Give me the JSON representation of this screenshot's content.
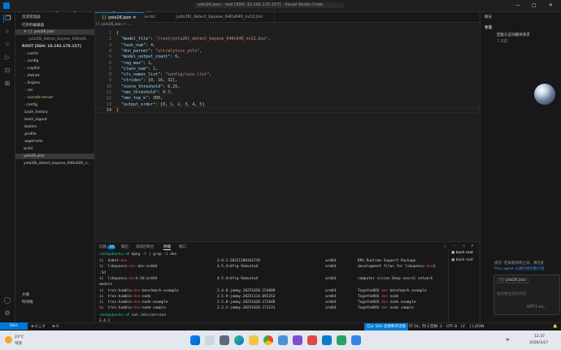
{
  "titlebar": {
    "menu": [
      "文件(F)",
      "编辑(E)",
      "选择(S)",
      "查看(V)",
      "转到(G)",
      "运行(R)",
      "终端(T)",
      "帮助(H)"
    ],
    "title": "yolo26.json - root [SSH: 10.192.170.157] - Visual Studio Code"
  },
  "sidebar": {
    "header": "资源管理器",
    "open_editors": "打开的编辑器",
    "open_files": [
      "yolo26.json",
      "yolo26l_detect_bayese_640x64..."
    ],
    "root": "ROOT [SSH: 10.192.170.157]",
    "items": [
      ".cache",
      ".config",
      ".copilot",
      ".dotnet",
      ".lingma",
      ".ros",
      ".vscode-server",
      "config",
      ".bash_history",
      ".bash_logout",
      ".bashrc",
      ".profile",
      ".wget-hsts",
      "w.list",
      "yolo26.json",
      "yolo26l_detect_bayese_640x640_n..."
    ],
    "outline": "大纲",
    "timeline": "时间线"
  },
  "tabs": [
    "yolo26.json",
    "w.list",
    "yolo26l_detect_bayese_640x640_nv12.bin"
  ],
  "breadcrumb": "{} yolo26.json > ...",
  "editor": {
    "lines": [
      [
        [
          "p",
          "{"
        ]
      ],
      [
        [
          "k",
          "\"model_file\""
        ],
        [
          "p",
          ": "
        ],
        [
          "s",
          "\"/root/yolo26l_detect_bayese_640x640_nv12.bin\""
        ],
        [
          "p",
          ","
        ]
      ],
      [
        [
          "k",
          "\"task_num\""
        ],
        [
          "p",
          ": "
        ],
        [
          "n",
          "4"
        ],
        [
          "p",
          ","
        ]
      ],
      [
        [
          "k",
          "\"dnn_parser\""
        ],
        [
          "p",
          ": "
        ],
        [
          "s",
          "\"ultralytics_yolo\""
        ],
        [
          "p",
          ","
        ]
      ],
      [
        [
          "k",
          "\"model_output_count\""
        ],
        [
          "p",
          ": "
        ],
        [
          "n",
          "6"
        ],
        [
          "p",
          ","
        ]
      ],
      [
        [
          "k",
          "\"reg_max\""
        ],
        [
          "p",
          ": "
        ],
        [
          "n",
          "1"
        ],
        [
          "p",
          ","
        ]
      ],
      [
        [
          "k",
          "\"class_num\""
        ],
        [
          "p",
          ": "
        ],
        [
          "n",
          "1"
        ],
        [
          "p",
          ","
        ]
      ],
      [
        [
          "k",
          "\"cls_names_list\""
        ],
        [
          "p",
          ": "
        ],
        [
          "s",
          "\"config/coco.list\""
        ],
        [
          "p",
          ","
        ]
      ],
      [
        [
          "k",
          "\"strides\""
        ],
        [
          "p",
          ": ["
        ],
        [
          "n",
          "8"
        ],
        [
          "p",
          ", "
        ],
        [
          "n",
          "16"
        ],
        [
          "p",
          ", "
        ],
        [
          "n",
          "32"
        ],
        [
          "p",
          "],"
        ]
      ],
      [
        [
          "k",
          "\"score_threshold\""
        ],
        [
          "p",
          ": "
        ],
        [
          "n",
          "0.25"
        ],
        [
          "p",
          ","
        ]
      ],
      [
        [
          "k",
          "\"nms_threshold\""
        ],
        [
          "p",
          ": "
        ],
        [
          "n",
          "0.7"
        ],
        [
          "p",
          ","
        ]
      ],
      [
        [
          "k",
          "\"nms_top_k\""
        ],
        [
          "p",
          ": "
        ],
        [
          "n",
          "300"
        ],
        [
          "p",
          ","
        ]
      ],
      [
        [
          "k",
          "\"output_order\""
        ],
        [
          "p",
          ": ["
        ],
        [
          "n",
          "0"
        ],
        [
          "p",
          ", "
        ],
        [
          "n",
          "1"
        ],
        [
          "p",
          ", "
        ],
        [
          "n",
          "2"
        ],
        [
          "p",
          ", "
        ],
        [
          "n",
          "3"
        ],
        [
          "p",
          ", "
        ],
        [
          "n",
          "4"
        ],
        [
          "p",
          ", "
        ],
        [
          "n",
          "5"
        ],
        [
          "p",
          "]"
        ]
      ],
      [
        [
          "b",
          "}"
        ]
      ]
    ]
  },
  "panel": {
    "tabs": [
      "问题",
      "输出",
      "调试控制台",
      "终端",
      "端口"
    ],
    "problems_count": "19",
    "cmd1": "dpkg -l | grep -i dnn",
    "prompt": "root@ubuntu:~#",
    "rows": [
      [
        "ii  hobot-",
        "dnn",
        "",
        "3.0.1-20251208164739",
        "arm64",
        "BPU Runtime Support Package",
        ""
      ],
      [
        "ii  libopencv-",
        "dnn",
        "-dev:arm64",
        "4.5.4+dfsg-9ubuntu4",
        "arm64",
        "development files for libopencv-",
        "dnn4"
      ],
      [
        ".5d",
        "",
        "",
        "",
        "",
        "",
        ""
      ],
      [
        "ii  libopencv-",
        "dnn",
        "4.5d:arm64",
        "4.5.4+dfsg-9ubuntu4",
        "arm64",
        "computer vision Deep neural network",
        ""
      ],
      [
        "module",
        "",
        "",
        "",
        "",
        "",
        ""
      ],
      [
        "ii  tros-humble-",
        "dnn",
        "-benchmark-example",
        "2.4.0-jammy.20251028.154809",
        "arm64",
        "TogetheROS ",
        "dnn benchmark example"
      ],
      [
        "ii  tros-humble-",
        "dnn",
        "-node",
        "2.5.9-jammy.20251114.092352",
        "arm64",
        "TogetheROS ",
        "dnn node"
      ],
      [
        "ii  tros-humble-",
        "dnn",
        "-node-example",
        "2.5.8-jammy.20251028.172848",
        "arm64",
        "TogetheROS ",
        "dnn node example"
      ],
      [
        "ii  tros-humble-",
        "dnn",
        "-node-sample",
        "2.3.2-jammy.20251028.173231",
        "arm64",
        "TogetheROS ",
        "dnn node sample"
      ]
    ],
    "cmd2": "cat /etc/version",
    "version_out": "3.4.1",
    "terminals": [
      "bash root",
      "bash root"
    ]
  },
  "chat": {
    "tab": "聊天",
    "header": "会话",
    "item1": "回复头这块翻译请求",
    "item1_sub": "7 天前",
    "tip1": "提示: 若未能修改之间，请在此",
    "tip2": "Plan agent 以进行研究和计划",
    "file_chip": "yolo26.json",
    "input_placeholder": "描述要生成的内容",
    "model": "GPT-5 mi..."
  },
  "status": {
    "remote": "SSH: 10.192.170.157",
    "problems": "⊗ 0 △ 0",
    "ports": "⊕ 0",
    "position": "行 14，列 2",
    "spaces": "空格: 2",
    "encoding": "UTF-8",
    "eol": "LF",
    "language": "{} JSON",
    "unsupported": "已从 SSH 连接断开连接"
  },
  "taskbar": {
    "weather_temp": "23°C",
    "weather_desc": "晴朗",
    "time": "12:37",
    "date": "2026/3/27",
    "lang": "中"
  }
}
